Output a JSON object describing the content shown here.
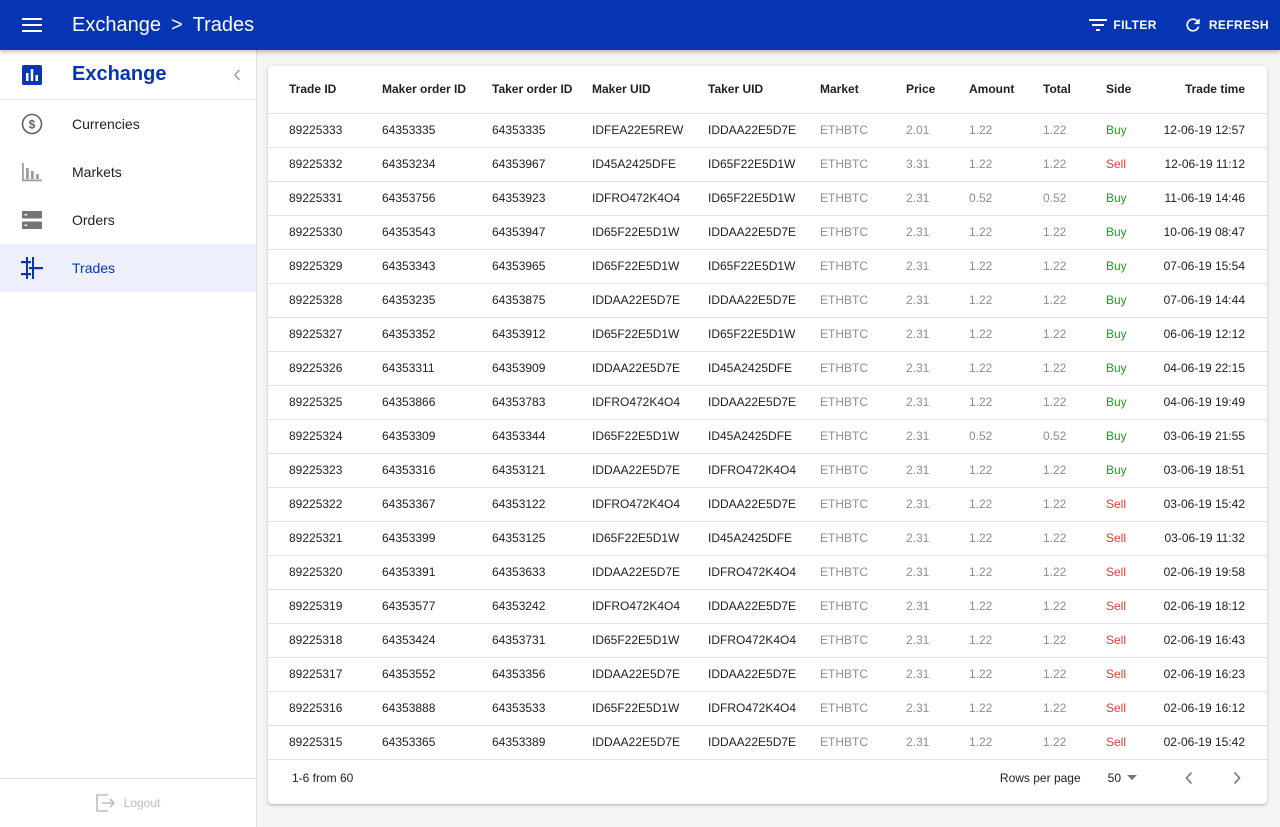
{
  "header": {
    "crumb_root": "Exchange",
    "crumb_sep": ">",
    "crumb_current": "Trades",
    "filter_label": "FILTER",
    "refresh_label": "REFRESH"
  },
  "sidebar": {
    "title": "Exchange",
    "items": [
      {
        "label": "Currencies",
        "icon": "currency-icon"
      },
      {
        "label": "Markets",
        "icon": "bar-chart-icon"
      },
      {
        "label": "Orders",
        "icon": "orders-icon"
      },
      {
        "label": "Trades",
        "icon": "trades-icon",
        "active": true
      }
    ],
    "logout_label": "Logout"
  },
  "table": {
    "columns": [
      "Trade ID",
      "Maker order ID",
      "Taker order ID",
      "Maker UID",
      "Taker UID",
      "Market",
      "Price",
      "Amount",
      "Total",
      "Side",
      "Trade time"
    ],
    "rows": [
      [
        "89225333",
        "64353335",
        "64353335",
        "IDFEA22E5REW",
        "IDDAA22E5D7E",
        "ETHBTC",
        "2.01",
        "1.22",
        "1.22",
        "Buy",
        "12-06-19 12:57"
      ],
      [
        "89225332",
        "64353234",
        "64353967",
        "ID45A2425DFE",
        "ID65F22E5D1W",
        "ETHBTC",
        "3.31",
        "1.22",
        "1.22",
        "Sell",
        "12-06-19 11:12"
      ],
      [
        "89225331",
        "64353756",
        "64353923",
        "IDFRO472K4O4",
        "ID65F22E5D1W",
        "ETHBTC",
        "2.31",
        "0.52",
        "0.52",
        "Buy",
        "11-06-19 14:46"
      ],
      [
        "89225330",
        "64353543",
        "64353947",
        "ID65F22E5D1W",
        "IDDAA22E5D7E",
        "ETHBTC",
        "2.31",
        "1.22",
        "1.22",
        "Buy",
        "10-06-19 08:47"
      ],
      [
        "89225329",
        "64353343",
        "64353965",
        "ID65F22E5D1W",
        "ID65F22E5D1W",
        "ETHBTC",
        "2.31",
        "1.22",
        "1.22",
        "Buy",
        "07-06-19 15:54"
      ],
      [
        "89225328",
        "64353235",
        "64353875",
        "IDDAA22E5D7E",
        "IDDAA22E5D7E",
        "ETHBTC",
        "2.31",
        "1.22",
        "1.22",
        "Buy",
        "07-06-19 14:44"
      ],
      [
        "89225327",
        "64353352",
        "64353912",
        "ID65F22E5D1W",
        "ID65F22E5D1W",
        "ETHBTC",
        "2.31",
        "1.22",
        "1.22",
        "Buy",
        "06-06-19 12:12"
      ],
      [
        "89225326",
        "64353311",
        "64353909",
        "IDDAA22E5D7E",
        "ID45A2425DFE",
        "ETHBTC",
        "2.31",
        "1.22",
        "1.22",
        "Buy",
        "04-06-19 22:15"
      ],
      [
        "89225325",
        "64353866",
        "64353783",
        "IDFRO472K4O4",
        "IDDAA22E5D7E",
        "ETHBTC",
        "2.31",
        "1.22",
        "1.22",
        "Buy",
        "04-06-19 19:49"
      ],
      [
        "89225324",
        "64353309",
        "64353344",
        "ID65F22E5D1W",
        "ID45A2425DFE",
        "ETHBTC",
        "2.31",
        "0.52",
        "0.52",
        "Buy",
        "03-06-19 21:55"
      ],
      [
        "89225323",
        "64353316",
        "64353121",
        "IDDAA22E5D7E",
        "IDFRO472K4O4",
        "ETHBTC",
        "2.31",
        "1.22",
        "1.22",
        "Buy",
        "03-06-19 18:51"
      ],
      [
        "89225322",
        "64353367",
        "64353122",
        "IDFRO472K4O4",
        "IDDAA22E5D7E",
        "ETHBTC",
        "2.31",
        "1.22",
        "1.22",
        "Sell",
        "03-06-19 15:42"
      ],
      [
        "89225321",
        "64353399",
        "64353125",
        "ID65F22E5D1W",
        "ID45A2425DFE",
        "ETHBTC",
        "2.31",
        "1.22",
        "1.22",
        "Sell",
        "03-06-19 11:32"
      ],
      [
        "89225320",
        "64353391",
        "64353633",
        "IDDAA22E5D7E",
        "IDFRO472K4O4",
        "ETHBTC",
        "2.31",
        "1.22",
        "1.22",
        "Sell",
        "02-06-19 19:58"
      ],
      [
        "89225319",
        "64353577",
        "64353242",
        "IDFRO472K4O4",
        "IDDAA22E5D7E",
        "ETHBTC",
        "2.31",
        "1.22",
        "1.22",
        "Sell",
        "02-06-19 18:12"
      ],
      [
        "89225318",
        "64353424",
        "64353731",
        "ID65F22E5D1W",
        "IDFRO472K4O4",
        "ETHBTC",
        "2.31",
        "1.22",
        "1.22",
        "Sell",
        "02-06-19 16:43"
      ],
      [
        "89225317",
        "64353552",
        "64353356",
        "IDDAA22E5D7E",
        "IDDAA22E5D7E",
        "ETHBTC",
        "2.31",
        "1.22",
        "1.22",
        "Sell",
        "02-06-19 16:23"
      ],
      [
        "89225316",
        "64353888",
        "64353533",
        "ID65F22E5D1W",
        "IDFRO472K4O4",
        "ETHBTC",
        "2.31",
        "1.22",
        "1.22",
        "Sell",
        "02-06-19 16:12"
      ],
      [
        "89225315",
        "64353365",
        "64353389",
        "IDDAA22E5D7E",
        "IDDAA22E5D7E",
        "ETHBTC",
        "2.31",
        "1.22",
        "1.22",
        "Sell",
        "02-06-19 15:42"
      ]
    ]
  },
  "pagination": {
    "range_text": "1-6 from 60",
    "rows_per_page_label": "Rows per page",
    "rows_per_page_value": "50"
  },
  "colors": {
    "primary": "#0535b2",
    "buy": "#1e9e1e",
    "sell": "#e53935"
  }
}
